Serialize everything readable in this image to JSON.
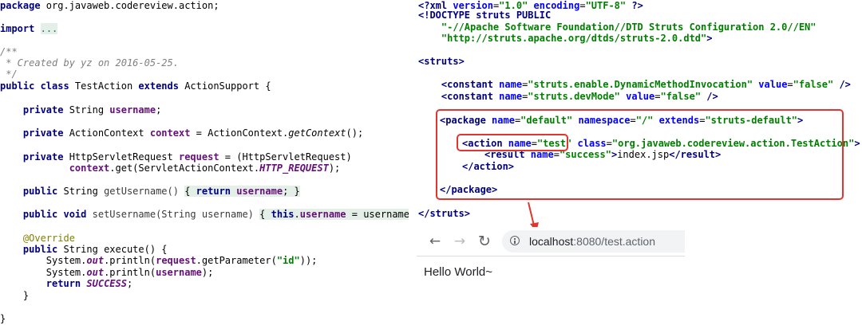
{
  "java": {
    "package_kw": "package",
    "package_name": " org.javaweb.codereview.action;",
    "import_kw": "import",
    "import_fold": "...",
    "comment_open": "/**",
    "comment_body": " * Created by yz on 2016-05-25.",
    "comment_close": " */",
    "class_kw1": "public class",
    "class_name": " TestAction ",
    "class_kw2": "extends",
    "class_super": " ActionSupport {",
    "f1_kw": "private",
    "f1_type": " String ",
    "f1_name": "username",
    "f1_end": ";",
    "f2_kw": "private",
    "f2_type": " ActionContext ",
    "f2_name": "context",
    "f2_eq": " = ActionContext.",
    "f2_call": "getContext",
    "f2_end": "();",
    "f3_kw": "private",
    "f3_type": " HttpServletRequest ",
    "f3_name": "request",
    "f3_eq": " = (HttpServletRequest)",
    "f3b_field": "context",
    "f3b_get": ".get(ServletActionContext.",
    "f3b_const": "HTTP_REQUEST",
    "f3b_end": ");",
    "g_kw": "public",
    "g_type": " String ",
    "g_name": "getUsername()",
    "g_body_open": "{ ",
    "g_ret": "return",
    "g_sp": " ",
    "g_field": "username",
    "g_body_close": "; }",
    "s_kw": "public void",
    "s_name": " setUsername(String username) ",
    "s_open": "{ ",
    "s_this": "this",
    "s_dot": ".",
    "s_field": "username",
    "s_rest": " = username; ",
    "s_close": "}",
    "ann": "@Override",
    "e_kw": "public",
    "e_sig": " String execute() {",
    "p1_a": "System.",
    "p1_out": "out",
    "p1_b": ".println(",
    "p1_req": "request",
    "p1_c": ".getParameter(",
    "p1_str": "\"id\"",
    "p1_d": "));",
    "p2_a": "System.",
    "p2_out": "out",
    "p2_b": ".println(",
    "p2_user": "username",
    "p2_c": ");",
    "r_kw": "return",
    "r_sp": " ",
    "r_const": "SUCCESS",
    "r_end": ";",
    "close_method": "}",
    "close_class": "}"
  },
  "xml": {
    "l1_a": "<?xml ",
    "l1_attr1": "version",
    "l1_eq1": "=",
    "l1_val1": "\"1.0\"",
    "l1_sp": " ",
    "l1_attr2": "encoding",
    "l1_eq2": "=",
    "l1_val2": "\"UTF-8\"",
    "l1_end": " ?>",
    "l2": "<!DOCTYPE struts PUBLIC",
    "l3": "\"-//Apache Software Foundation//DTD Struts Configuration 2.0//EN\"",
    "l4_val": "\"http://struts.apache.org/dtds/struts-2.0.dtd\"",
    "l4_end": ">",
    "struts_open": "<struts>",
    "c1_tag": "<constant ",
    "c1_an": "name",
    "c1_eq": "=",
    "c1_av": "\"struts.enable.DynamicMethodInvocation\"",
    "c1_sp": " ",
    "c1_bn": "value",
    "c1_eq2": "=",
    "c1_bv": "\"false\"",
    "c1_end": " />",
    "c2_tag": "<constant ",
    "c2_an": "name",
    "c2_eq": "=",
    "c2_av": "\"struts.devMode\"",
    "c2_sp": " ",
    "c2_bn": "value",
    "c2_eq2": "=",
    "c2_bv": "\"false\"",
    "c2_end": " />",
    "pk_tag": "<package ",
    "pk_a1": "name",
    "pk_e1": "=",
    "pk_v1": "\"default\"",
    "pk_s1": " ",
    "pk_a2": "namespace",
    "pk_e2": "=",
    "pk_v2": "\"/\"",
    "pk_s2": " ",
    "pk_a3": "extends",
    "pk_e3": "=",
    "pk_v3": "\"struts-default\"",
    "pk_end": ">",
    "ac_tag": "<action ",
    "ac_a1": "name",
    "ac_e1": "=",
    "ac_v1": "\"test\"",
    "ac_s1": " ",
    "ac_a2": "class",
    "ac_e2": "=",
    "ac_v2": "\"org.javaweb.codereview.action.TestAction\"",
    "ac_end": ">",
    "rs_tag": "<result ",
    "rs_a1": "name",
    "rs_e1": "=",
    "rs_v1": "\"success\"",
    "rs_gt": ">",
    "rs_text": "index.jsp",
    "rs_close": "</result>",
    "ac_close": "</action>",
    "pk_close": "</package>",
    "struts_close": "</struts>"
  },
  "browser": {
    "back": "←",
    "forward": "→",
    "reload": "↻",
    "host": "localhost",
    "path": ":8080/test.action",
    "page_text": "Hello World~"
  },
  "colors": {
    "highlight_box": "#e0362f",
    "keyword": "#000080",
    "field": "#660e7a",
    "string": "#008000"
  }
}
